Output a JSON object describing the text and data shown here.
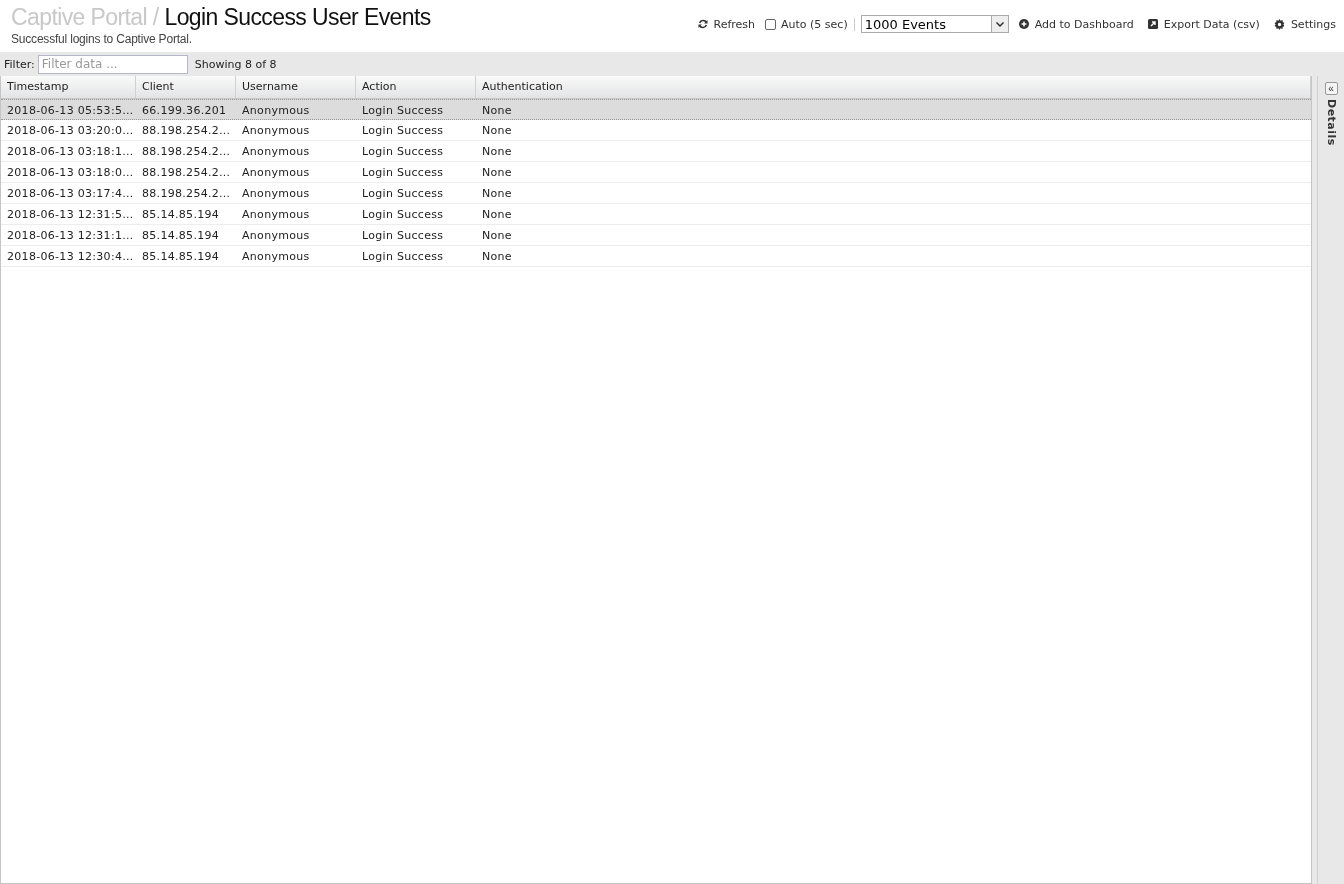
{
  "header": {
    "breadcrumb": "Captive Portal /",
    "title": "Login Success User Events",
    "subtitle": "Successful logins to Captive Portal."
  },
  "toolbar": {
    "refresh": "Refresh",
    "auto": {
      "label": "Auto (5 sec)",
      "checked": false
    },
    "events_select": "1000 Events",
    "add_to_dashboard": "Add to Dashboard",
    "export": "Export Data (csv)",
    "settings": "Settings"
  },
  "filter": {
    "label": "Filter:",
    "placeholder": "Filter data ...",
    "count": "Showing 8 of 8"
  },
  "table": {
    "columns": [
      "Timestamp",
      "Client",
      "Username",
      "Action",
      "Authentication"
    ],
    "rows": [
      {
        "selected": true,
        "cells": [
          "2018-06-13 05:53:5…",
          "66.199.36.201",
          "Anonymous",
          "Login Success",
          "None"
        ]
      },
      {
        "selected": false,
        "cells": [
          "2018-06-13 03:20:0…",
          "88.198.254.2…",
          "Anonymous",
          "Login Success",
          "None"
        ]
      },
      {
        "selected": false,
        "cells": [
          "2018-06-13 03:18:1…",
          "88.198.254.2…",
          "Anonymous",
          "Login Success",
          "None"
        ]
      },
      {
        "selected": false,
        "cells": [
          "2018-06-13 03:18:0…",
          "88.198.254.2…",
          "Anonymous",
          "Login Success",
          "None"
        ]
      },
      {
        "selected": false,
        "cells": [
          "2018-06-13 03:17:4…",
          "88.198.254.2…",
          "Anonymous",
          "Login Success",
          "None"
        ]
      },
      {
        "selected": false,
        "cells": [
          "2018-06-13 12:31:5…",
          "85.14.85.194",
          "Anonymous",
          "Login Success",
          "None"
        ]
      },
      {
        "selected": false,
        "cells": [
          "2018-06-13 12:31:1…",
          "85.14.85.194",
          "Anonymous",
          "Login Success",
          "None"
        ]
      },
      {
        "selected": false,
        "cells": [
          "2018-06-13 12:30:4…",
          "85.14.85.194",
          "Anonymous",
          "Login Success",
          "None"
        ]
      }
    ]
  },
  "details_panel": {
    "collapse": "«",
    "label": "Details"
  }
}
